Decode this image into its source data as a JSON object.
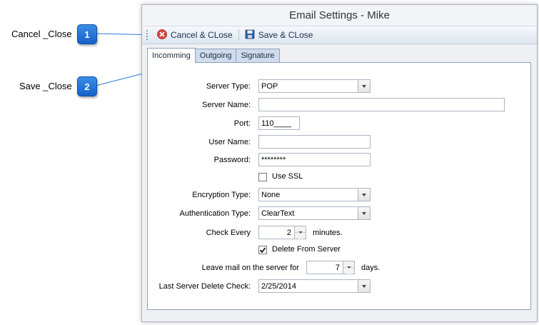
{
  "callouts": [
    {
      "number": "1",
      "label": "Cancel _Close"
    },
    {
      "number": "2",
      "label": "Save _Close"
    }
  ],
  "window": {
    "title": "Email Settings - Mike"
  },
  "toolbar": {
    "cancel_label": "Cancel & CLose",
    "save_label": "Save & CLose"
  },
  "tabs": [
    {
      "label": "Incomming",
      "active": true
    },
    {
      "label": "Outgoing",
      "active": false
    },
    {
      "label": "Signature",
      "active": false
    }
  ],
  "form": {
    "server_type": {
      "label": "Server Type:",
      "value": "POP"
    },
    "server_name": {
      "label": "Server Name:",
      "value": ""
    },
    "port": {
      "label": "Port:",
      "value": "110____"
    },
    "user_name": {
      "label": "User Name:",
      "value": ""
    },
    "password": {
      "label": "Password:",
      "value": "********"
    },
    "use_ssl": {
      "label": "Use SSL",
      "checked": false
    },
    "encryption_type": {
      "label": "Encryption Type:",
      "value": "None"
    },
    "authentication_type": {
      "label": "Authentication Type:",
      "value": "ClearText"
    },
    "check_every": {
      "label": "Check Every",
      "value": "2",
      "suffix": "minutes."
    },
    "delete_from_server": {
      "label": "Delete From Server",
      "checked": true
    },
    "leave_mail": {
      "label": "Leave mail on the server for",
      "value": "7",
      "suffix": "days."
    },
    "last_delete_check": {
      "label": "Last Server Delete Check:",
      "value": "2/25/2014"
    }
  },
  "icons": {
    "cancel": "cancel-circle-icon",
    "save": "floppy-disk-icon"
  }
}
